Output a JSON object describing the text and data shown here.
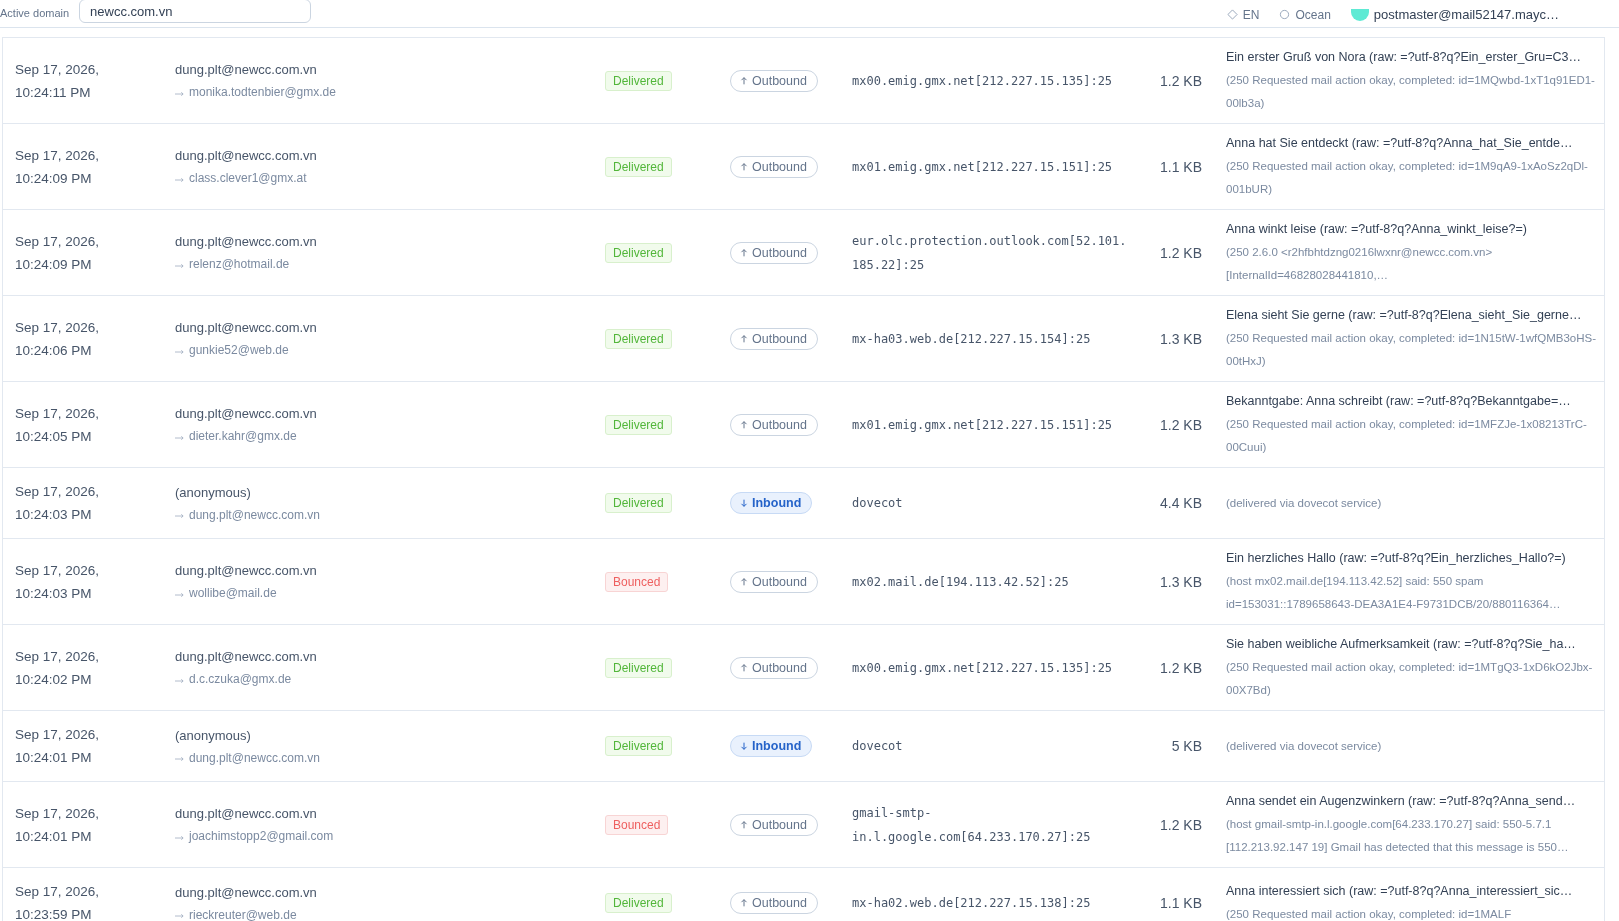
{
  "header": {
    "domain_label": "Active domain",
    "domain_value": "newcc.com.vn",
    "language": "EN",
    "theme": "Ocean",
    "account": "postmaster@mail52147.mayc…"
  },
  "rows": [
    {
      "date": "Sep 17, 2026, 10:24:11 PM",
      "sender": "dung.plt@newcc.com.vn",
      "recipient": "monika.todtenbier@gmx.de",
      "status": {
        "kind": "delivered",
        "label": "Delivered"
      },
      "direction": {
        "kind": "outbound",
        "label": "Outbound"
      },
      "relay": "mx00.emig.gmx.net[212.227.15.135]:25",
      "size": "1.2 KB",
      "subject": "Ein erster Gruß von Nora (raw: =?utf-8?q?Ein_erster_Gru=C3…",
      "response": "(250 Requested mail action okay, completed: id=1MQwbd-1xT1q91ED1-00lb3a)"
    },
    {
      "date": "Sep 17, 2026, 10:24:09 PM",
      "sender": "dung.plt@newcc.com.vn",
      "recipient": "class.clever1@gmx.at",
      "status": {
        "kind": "delivered",
        "label": "Delivered"
      },
      "direction": {
        "kind": "outbound",
        "label": "Outbound"
      },
      "relay": "mx01.emig.gmx.net[212.227.15.151]:25",
      "size": "1.1 KB",
      "subject": "Anna hat Sie entdeckt (raw: =?utf-8?q?Anna_hat_Sie_entde…",
      "response": "(250 Requested mail action okay, completed: id=1M9qA9-1xAoSz2qDl-001bUR)"
    },
    {
      "date": "Sep 17, 2026, 10:24:09 PM",
      "sender": "dung.plt@newcc.com.vn",
      "recipient": "relenz@hotmail.de",
      "status": {
        "kind": "delivered",
        "label": "Delivered"
      },
      "direction": {
        "kind": "outbound",
        "label": "Outbound"
      },
      "relay": "eur.olc.protection.outlook.com[52.101.185.22]:25",
      "size": "1.2 KB",
      "subject": "Anna winkt leise (raw: =?utf-8?q?Anna_winkt_leise?=)",
      "response": "(250 2.6.0 <r2hfbhtdzng0216lwxnr@newcc.com.vn> [InternalId=46828028441810,…"
    },
    {
      "date": "Sep 17, 2026, 10:24:06 PM",
      "sender": "dung.plt@newcc.com.vn",
      "recipient": "gunkie52@web.de",
      "status": {
        "kind": "delivered",
        "label": "Delivered"
      },
      "direction": {
        "kind": "outbound",
        "label": "Outbound"
      },
      "relay": "mx-ha03.web.de[212.227.15.154]:25",
      "size": "1.3 KB",
      "subject": "Elena sieht Sie gerne (raw: =?utf-8?q?Elena_sieht_Sie_gerne…",
      "response": "(250 Requested mail action okay, completed: id=1N15tW-1wfQMB3oHS-00tHxJ)"
    },
    {
      "date": "Sep 17, 2026, 10:24:05 PM",
      "sender": "dung.plt@newcc.com.vn",
      "recipient": "dieter.kahr@gmx.de",
      "status": {
        "kind": "delivered",
        "label": "Delivered"
      },
      "direction": {
        "kind": "outbound",
        "label": "Outbound"
      },
      "relay": "mx01.emig.gmx.net[212.227.15.151]:25",
      "size": "1.2 KB",
      "subject": "Bekanntgabe: Anna schreibt (raw: =?utf-8?q?Bekanntgabe=…",
      "response": "(250 Requested mail action okay, completed: id=1MFZJe-1x08213TrC-00Cuui)"
    },
    {
      "date": "Sep 17, 2026, 10:24:03 PM",
      "sender": "(anonymous)",
      "recipient": "dung.plt@newcc.com.vn",
      "status": {
        "kind": "delivered",
        "label": "Delivered"
      },
      "direction": {
        "kind": "inbound",
        "label": "Inbound"
      },
      "relay": "dovecot",
      "size": "4.4 KB",
      "response": "(delivered via dovecot service)"
    },
    {
      "date": "Sep 17, 2026, 10:24:03 PM",
      "sender": "dung.plt@newcc.com.vn",
      "recipient": "wollibe@mail.de",
      "status": {
        "kind": "bounced",
        "label": "Bounced"
      },
      "direction": {
        "kind": "outbound",
        "label": "Outbound"
      },
      "relay": "mx02.mail.de[194.113.42.52]:25",
      "size": "1.3 KB",
      "subject": "Ein herzliches Hallo (raw: =?utf-8?q?Ein_herzliches_Hallo?=)",
      "response": "(host mx02.mail.de[194.113.42.52] said: 550 spam id=153031::1789658643-DEA3A1E4-F9731DCB/20/880116364…"
    },
    {
      "date": "Sep 17, 2026, 10:24:02 PM",
      "sender": "dung.plt@newcc.com.vn",
      "recipient": "d.c.czuka@gmx.de",
      "status": {
        "kind": "delivered",
        "label": "Delivered"
      },
      "direction": {
        "kind": "outbound",
        "label": "Outbound"
      },
      "relay": "mx00.emig.gmx.net[212.227.15.135]:25",
      "size": "1.2 KB",
      "subject": "Sie haben weibliche Aufmerksamkeit (raw: =?utf-8?q?Sie_ha…",
      "response": "(250 Requested mail action okay, completed: id=1MTgQ3-1xD6kO2Jbx-00X7Bd)"
    },
    {
      "date": "Sep 17, 2026, 10:24:01 PM",
      "sender": "(anonymous)",
      "recipient": "dung.plt@newcc.com.vn",
      "status": {
        "kind": "delivered",
        "label": "Delivered"
      },
      "direction": {
        "kind": "inbound",
        "label": "Inbound"
      },
      "relay": "dovecot",
      "size": "5 KB",
      "response": "(delivered via dovecot service)"
    },
    {
      "date": "Sep 17, 2026, 10:24:01 PM",
      "sender": "dung.plt@newcc.com.vn",
      "recipient": "joachimstopp2@gmail.com",
      "status": {
        "kind": "bounced",
        "label": "Bounced"
      },
      "direction": {
        "kind": "outbound",
        "label": "Outbound"
      },
      "relay": "gmail-smtp-in.l.google.com[64.233.170.27]:25",
      "size": "1.2 KB",
      "subject": "Anna sendet ein Augenzwinkern (raw: =?utf-8?q?Anna_send…",
      "response": "(host gmail-smtp-in.l.google.com[64.233.170.27] said: 550-5.7.1 [112.213.92.147 19] Gmail has detected that this message is 550…"
    },
    {
      "date": "Sep 17, 2026, 10:23:59 PM",
      "sender": "dung.plt@newcc.com.vn",
      "recipient": "rieckreuter@web.de",
      "status": {
        "kind": "delivered",
        "label": "Delivered"
      },
      "direction": {
        "kind": "outbound",
        "label": "Outbound"
      },
      "relay": "mx-ha02.web.de[212.227.15.138]:25",
      "size": "1.1 KB",
      "subject": "Anna interessiert sich (raw: =?utf-8?q?Anna_interessiert_sic…",
      "response": "(250 Requested mail action okay, completed: id=1MALF"
    }
  ]
}
